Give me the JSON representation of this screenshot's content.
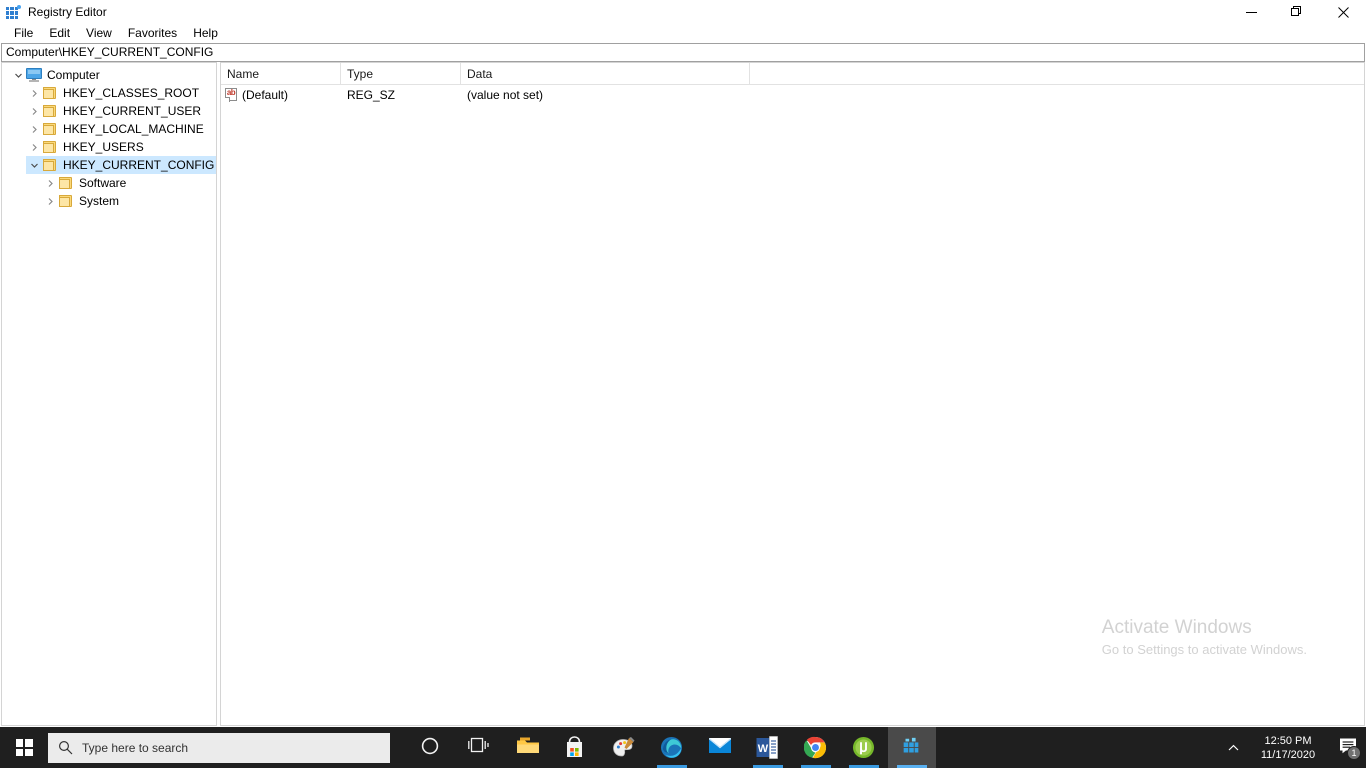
{
  "window": {
    "title": "Registry Editor",
    "icon": "registry-icon",
    "controls": {
      "minimize": "minimize-icon",
      "restore": "restore-icon",
      "close": "close-icon"
    }
  },
  "menu": {
    "items": [
      {
        "label": "File"
      },
      {
        "label": "Edit"
      },
      {
        "label": "View"
      },
      {
        "label": "Favorites"
      },
      {
        "label": "Help"
      }
    ]
  },
  "address_bar": {
    "value": "Computer\\HKEY_CURRENT_CONFIG"
  },
  "tree": {
    "nodes": [
      {
        "label": "Computer",
        "icon": "monitor-icon",
        "depth": 0,
        "expanded": true,
        "selected": false
      },
      {
        "label": "HKEY_CLASSES_ROOT",
        "icon": "folder-icon",
        "depth": 1,
        "expanded": false,
        "selected": false
      },
      {
        "label": "HKEY_CURRENT_USER",
        "icon": "folder-icon",
        "depth": 1,
        "expanded": false,
        "selected": false
      },
      {
        "label": "HKEY_LOCAL_MACHINE",
        "icon": "folder-icon",
        "depth": 1,
        "expanded": false,
        "selected": false
      },
      {
        "label": "HKEY_USERS",
        "icon": "folder-icon",
        "depth": 1,
        "expanded": false,
        "selected": false
      },
      {
        "label": "HKEY_CURRENT_CONFIG",
        "icon": "folder-icon",
        "depth": 1,
        "expanded": true,
        "selected": true
      },
      {
        "label": "Software",
        "icon": "folder-icon",
        "depth": 2,
        "expanded": false,
        "selected": false
      },
      {
        "label": "System",
        "icon": "folder-icon",
        "depth": 2,
        "expanded": false,
        "selected": false
      }
    ],
    "selection_color": "#cce8ff"
  },
  "list": {
    "columns": [
      {
        "label": "Name"
      },
      {
        "label": "Type"
      },
      {
        "label": "Data"
      }
    ],
    "rows": [
      {
        "icon": "string-value-icon",
        "name": "(Default)",
        "type": "REG_SZ",
        "data": "(value not set)"
      }
    ]
  },
  "watermark": {
    "title": "Activate Windows",
    "subtitle": "Go to Settings to activate Windows.",
    "color": "#d2d2d2"
  },
  "taskbar": {
    "start": {
      "icon": "windows-logo-icon"
    },
    "search": {
      "placeholder": "Type here to search",
      "icon": "search-icon"
    },
    "items": [
      {
        "name": "cortana",
        "icon": "cortana-circle-icon",
        "running": false,
        "active": false
      },
      {
        "name": "task-view",
        "icon": "task-view-icon",
        "running": false,
        "active": false
      },
      {
        "name": "file-explorer",
        "icon": "file-explorer-icon",
        "running": false,
        "active": false
      },
      {
        "name": "microsoft-store",
        "icon": "microsoft-store-icon",
        "running": false,
        "active": false
      },
      {
        "name": "paint",
        "icon": "paint-icon",
        "running": false,
        "active": false
      },
      {
        "name": "microsoft-edge",
        "icon": "edge-icon",
        "running": true,
        "active": false
      },
      {
        "name": "mail",
        "icon": "mail-icon",
        "running": false,
        "active": false
      },
      {
        "name": "word",
        "icon": "word-icon",
        "running": true,
        "active": false
      },
      {
        "name": "chrome",
        "icon": "chrome-icon",
        "running": true,
        "active": false
      },
      {
        "name": "utorrent",
        "icon": "utorrent-icon",
        "running": true,
        "active": false
      },
      {
        "name": "registry-editor",
        "icon": "registry-icon",
        "running": true,
        "active": true
      }
    ],
    "tray": {
      "chevron": "show-hidden-icons-chevron",
      "time": "12:50 PM",
      "date": "11/17/2020",
      "action_center_icon": "action-center-icon",
      "notification_count": "1"
    }
  }
}
